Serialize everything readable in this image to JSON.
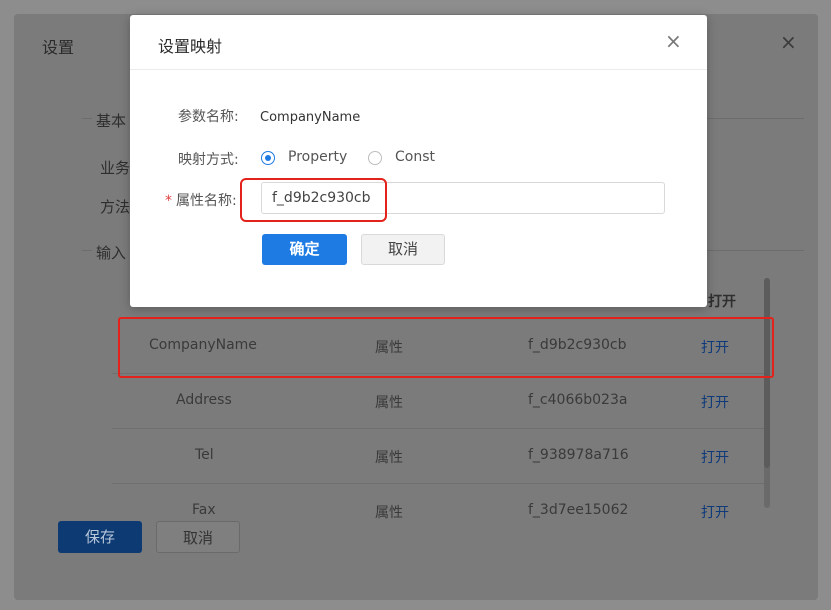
{
  "outer": {
    "title": "设置",
    "close": "×",
    "section_basic": "基本",
    "label_business": "业务",
    "label_method": "方法",
    "section_input": "输入",
    "header_open": "打开",
    "rows": [
      {
        "name": "CompanyName",
        "type": "属性",
        "value": "f_d9b2c930cb",
        "action": "打开"
      },
      {
        "name": "Address",
        "type": "属性",
        "value": "f_c4066b023a",
        "action": "打开"
      },
      {
        "name": "Tel",
        "type": "属性",
        "value": "f_938978a716",
        "action": "打开"
      },
      {
        "name": "Fax",
        "type": "属性",
        "value": "f_3d7ee15062",
        "action": "打开"
      }
    ],
    "save_label": "保存",
    "cancel_label": "取消"
  },
  "modal": {
    "title": "设置映射",
    "close": "×",
    "param_label": "参数名称:",
    "param_value": "CompanyName",
    "mapping_label": "映射方式:",
    "options": [
      {
        "label": "Property",
        "checked": true
      },
      {
        "label": "Const",
        "checked": false
      }
    ],
    "required_mark": "*",
    "attr_label": "属性名称:",
    "attr_value": "f_d9b2c930cb",
    "ok_label": "确定",
    "cancel_label": "取消"
  },
  "colors": {
    "primary": "#1e7be3",
    "highlight": "#e3231b"
  }
}
